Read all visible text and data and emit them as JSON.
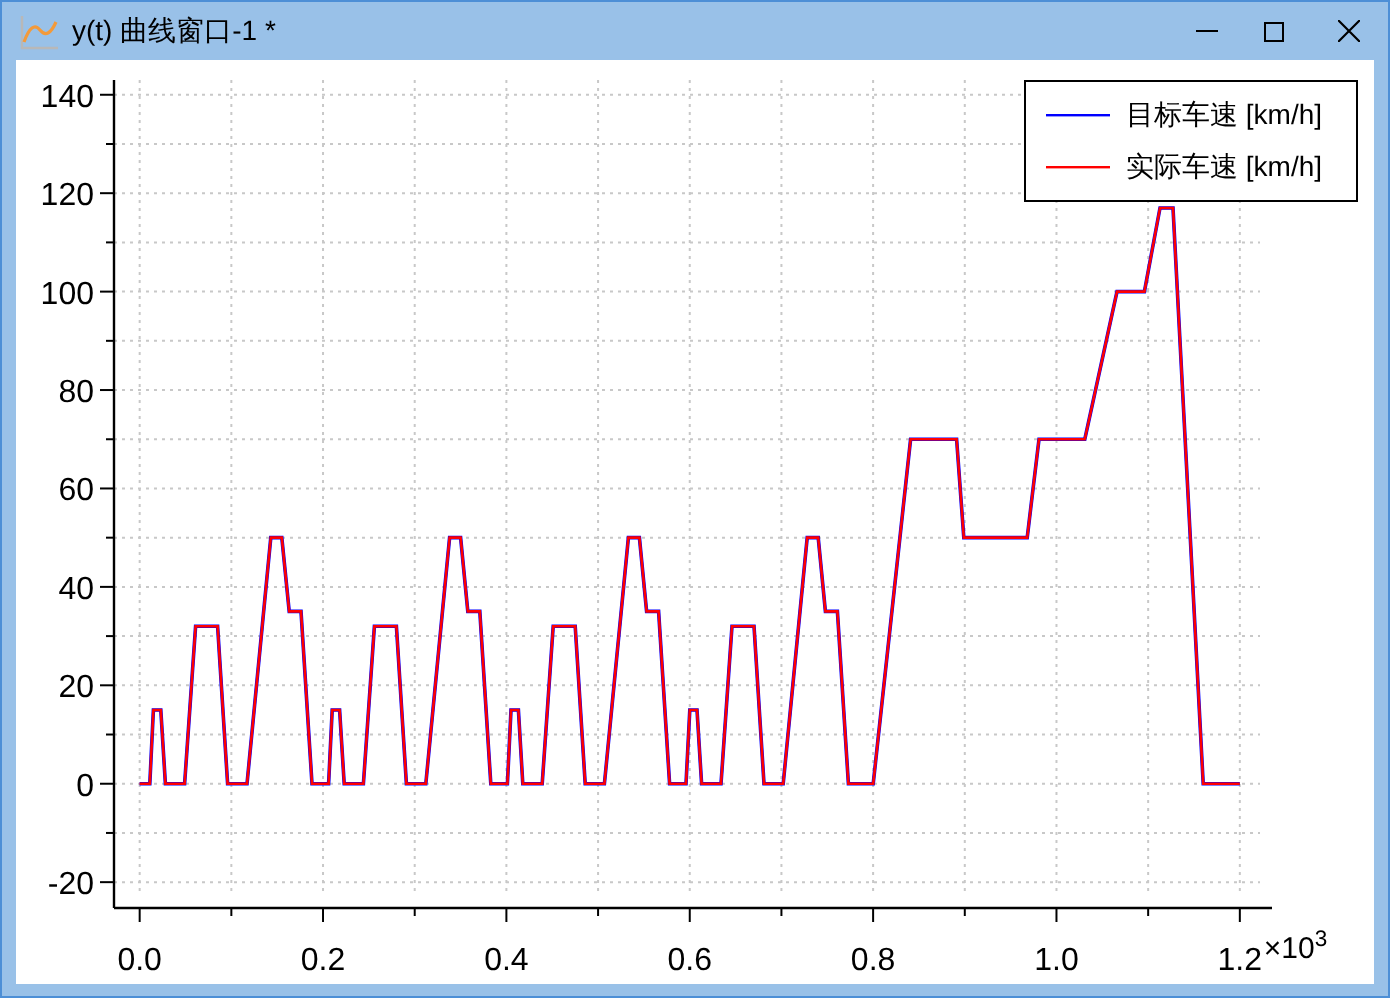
{
  "window": {
    "title": "y(t) 曲线窗口-1 *"
  },
  "chart": {
    "x_multiplier": "×10$^{3}$",
    "chart_data": {
      "type": "line",
      "x": [
        0,
        0.011,
        0.015,
        0.023,
        0.028,
        0.049,
        0.061,
        0.085,
        0.096,
        0.117,
        0.143,
        0.155,
        0.163,
        0.176,
        0.188,
        0.195,
        0.206,
        0.21,
        0.218,
        0.223,
        0.244,
        0.256,
        0.28,
        0.291,
        0.312,
        0.338,
        0.35,
        0.358,
        0.371,
        0.383,
        0.39,
        0.401,
        0.405,
        0.413,
        0.418,
        0.439,
        0.451,
        0.475,
        0.486,
        0.507,
        0.533,
        0.545,
        0.553,
        0.566,
        0.578,
        0.585,
        0.596,
        0.6,
        0.608,
        0.613,
        0.634,
        0.646,
        0.67,
        0.681,
        0.702,
        0.728,
        0.74,
        0.748,
        0.761,
        0.773,
        0.78,
        0.8,
        0.841,
        0.891,
        0.899,
        0.968,
        0.981,
        1.031,
        1.066,
        1.096,
        1.113,
        1.127,
        1.16,
        1.2
      ],
      "series": [
        {
          "name": "目标车速 [km/h]",
          "color": "#0000ff",
          "values": [
            0,
            0,
            15,
            15,
            0,
            0,
            32,
            32,
            0,
            0,
            50,
            50,
            35,
            35,
            0,
            0,
            0,
            15,
            15,
            0,
            0,
            32,
            32,
            0,
            0,
            50,
            50,
            35,
            35,
            0,
            0,
            0,
            15,
            15,
            0,
            0,
            32,
            32,
            0,
            0,
            50,
            50,
            35,
            35,
            0,
            0,
            0,
            15,
            15,
            0,
            0,
            32,
            32,
            0,
            0,
            50,
            50,
            35,
            35,
            0,
            0,
            0,
            70,
            70,
            50,
            50,
            70,
            70,
            100,
            100,
            117,
            117,
            0,
            0
          ]
        },
        {
          "name": "实际车速 [km/h]",
          "color": "#ff0000",
          "values": [
            0,
            0,
            15,
            15,
            0,
            0,
            32,
            32,
            0,
            0,
            50,
            50,
            35,
            35,
            0,
            0,
            0,
            15,
            15,
            0,
            0,
            32,
            32,
            0,
            0,
            50,
            50,
            35,
            35,
            0,
            0,
            0,
            15,
            15,
            0,
            0,
            32,
            32,
            0,
            0,
            50,
            50,
            35,
            35,
            0,
            0,
            0,
            15,
            15,
            0,
            0,
            32,
            32,
            0,
            0,
            50,
            50,
            35,
            35,
            0,
            0,
            0,
            70,
            70,
            50,
            50,
            70,
            70,
            100,
            100,
            117,
            117,
            0,
            0
          ]
        }
      ],
      "grid": true,
      "xlim": [
        -0.028,
        1.222
      ],
      "ylim": [
        -22,
        143
      ],
      "xticks": [
        {
          "value": 0,
          "label": "0.0"
        },
        0.2,
        0.4,
        0.6,
        0.8,
        {
          "value": 1,
          "label": "1.0"
        },
        {
          "value": 1.2,
          "label": "1.2"
        }
      ],
      "yticks": [
        -20,
        0,
        20,
        40,
        60,
        80,
        100,
        120,
        140
      ]
    }
  }
}
